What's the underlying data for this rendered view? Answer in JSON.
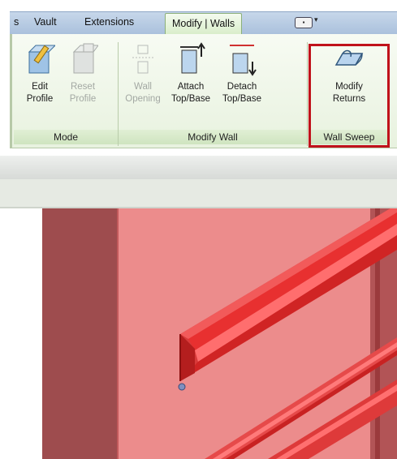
{
  "ribbon": {
    "tabs": [
      {
        "label": "s"
      },
      {
        "label": "Vault"
      },
      {
        "label": "Extensions"
      },
      {
        "label": "Modify | Walls"
      }
    ],
    "panels": {
      "mode": {
        "title": "Mode",
        "buttons": [
          {
            "line1": "Edit",
            "line2": "Profile",
            "enabled": true
          },
          {
            "line1": "Reset",
            "line2": "Profile",
            "enabled": false
          }
        ]
      },
      "modify_wall": {
        "title": "Modify Wall",
        "buttons": [
          {
            "line1": "Wall",
            "line2": "Opening",
            "enabled": false
          },
          {
            "line1": "Attach",
            "line2": "Top/Base",
            "enabled": true
          },
          {
            "line1": "Detach",
            "line2": "Top/Base",
            "enabled": true
          }
        ]
      },
      "wall_sweep": {
        "title": "Wall Sweep",
        "buttons": [
          {
            "line1": "Modify",
            "line2": "Returns",
            "enabled": true
          }
        ]
      }
    }
  },
  "colors": {
    "highlight": "#c0121b",
    "wall": "#ec8c8c",
    "wall_dark": "#9e4c4e",
    "sweep": "#e02a2a"
  },
  "icons": [
    "edit-profile-icon",
    "reset-profile-icon",
    "wall-opening-icon",
    "attach-top-base-icon",
    "detach-top-base-icon",
    "modify-returns-icon",
    "quick-access-icon",
    "chevron-down-icon"
  ]
}
